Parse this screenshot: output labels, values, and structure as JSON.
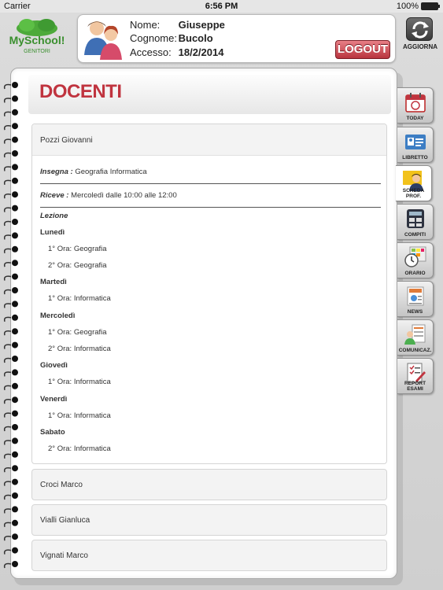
{
  "status_bar": {
    "carrier": "Carrier",
    "time": "6:56 PM",
    "battery": "100%"
  },
  "logo": {
    "name": "MySchool!",
    "subtitle": "GENITORI"
  },
  "user": {
    "nome_label": "Nome:",
    "nome": "Giuseppe",
    "cognome_label": "Cognome:",
    "cognome": "Bucolo",
    "accesso_label": "Accesso:",
    "accesso": "18/2/2014",
    "logout_label": "LOGOUT"
  },
  "refresh": {
    "label": "AGGIORNA",
    "icon": "refresh-icon"
  },
  "page_title": "DOCENTI",
  "teachers": [
    {
      "name": "Pozzi Giovanni",
      "insegna_label": "Insegna :",
      "insegna": "Geografia  Informatica",
      "riceve_label": "Riceve :",
      "riceve": "Mercoledì dalle 10:00 alle 12:00",
      "lezione_label": "Lezione",
      "schedule": [
        {
          "day": "Lunedì",
          "hours": [
            "1° Ora: Geografia",
            "2° Ora: Geografia"
          ]
        },
        {
          "day": "Martedì",
          "hours": [
            "1° Ora: Informatica"
          ]
        },
        {
          "day": "Mercoledì",
          "hours": [
            "1° Ora: Geografia",
            "2° Ora: Informatica"
          ]
        },
        {
          "day": "Giovedì",
          "hours": [
            "1° Ora: Informatica"
          ]
        },
        {
          "day": "Venerdì",
          "hours": [
            "1° Ora: Informatica"
          ]
        },
        {
          "day": "Sabato",
          "hours": [
            "2° Ora: Informatica"
          ]
        }
      ]
    },
    {
      "name": "Croci Marco"
    },
    {
      "name": "Vialli Gianluca"
    },
    {
      "name": "Vignati Marco"
    }
  ],
  "tabs": [
    {
      "label": "TODAY",
      "icon": "calendar-icon"
    },
    {
      "label": "LIBRETTO",
      "icon": "id-card-icon"
    },
    {
      "label": "SCHEDA PROF.",
      "icon": "teacher-icon"
    },
    {
      "label": "COMPITI",
      "icon": "calculator-icon"
    },
    {
      "label": "ORARIO",
      "icon": "clock-icon"
    },
    {
      "label": "NEWS",
      "icon": "news-icon"
    },
    {
      "label": "COMUNICAZ.",
      "icon": "communication-icon"
    },
    {
      "label": "REPORT ESAMI",
      "icon": "report-icon"
    }
  ],
  "colors": {
    "accent": "#c0343f",
    "logout": "#b8343e",
    "logo_green": "#3f9a32"
  }
}
